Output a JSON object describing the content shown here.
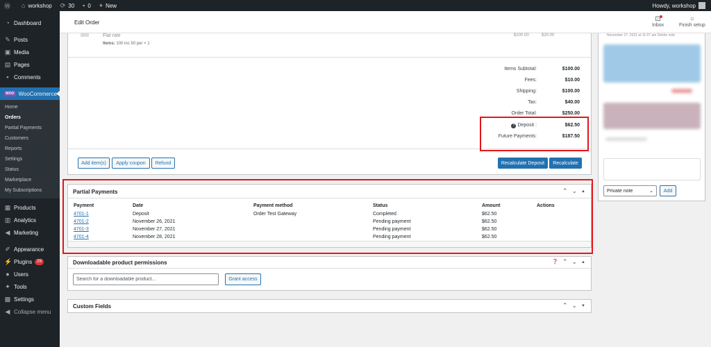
{
  "adminbar": {
    "site_name": "workshop",
    "updates_count": "30",
    "comments_count": "0",
    "new_label": "New",
    "howdy": "Howdy, workshop"
  },
  "sidebar": {
    "top_items": [
      {
        "label": "Dashboard",
        "icon": "dashboard-icon"
      },
      {
        "label": "Posts",
        "icon": "pin-icon"
      },
      {
        "label": "Media",
        "icon": "media-icon"
      },
      {
        "label": "Pages",
        "icon": "pages-icon"
      },
      {
        "label": "Comments",
        "icon": "comment-icon"
      }
    ],
    "woocommerce": {
      "label": "WooCommerce",
      "badge": "WOO"
    },
    "woo_submenu": [
      "Home",
      "Orders",
      "Partial Payments",
      "Customers",
      "Reports",
      "Settings",
      "Status",
      "Marketplace",
      "My Subscriptions"
    ],
    "active_submenu": "Orders",
    "bottom_items": [
      {
        "label": "Products"
      },
      {
        "label": "Analytics"
      },
      {
        "label": "Marketing"
      },
      {
        "label": "Appearance"
      },
      {
        "label": "Plugins",
        "badge": "29"
      },
      {
        "label": "Users"
      },
      {
        "label": "Tools"
      },
      {
        "label": "Settings"
      },
      {
        "label": "Collapse menu"
      }
    ]
  },
  "header": {
    "title": "Edit Order",
    "inbox_label": "Inbox",
    "finish_setup_label": "Finish setup"
  },
  "items": {
    "faded_shipping": "Flat rate",
    "faded_cost_1": "$100.00",
    "faded_cost_2": "$20.00",
    "meta_label": "Items:",
    "meta_value": "100 inc 50 per × 1"
  },
  "totals": {
    "subtotal_label": "Items Subtotal:",
    "subtotal_value": "$100.00",
    "fees_label": "Fees:",
    "fees_value": "$10.00",
    "shipping_label": "Shipping:",
    "shipping_value": "$100.00",
    "tax_label": "Tax:",
    "tax_value": "$40.00",
    "order_total_label": "Order Total:",
    "order_total_value": "$250.00",
    "deposit_label": "Deposit :",
    "deposit_value": "$62.50",
    "future_label": "Future Payments:",
    "future_value": "$187.50"
  },
  "actions": {
    "add_items": "Add item(s)",
    "apply_coupon": "Apply coupon",
    "refund": "Refund",
    "recalc_deposit": "Recalculate Deposit",
    "recalculate": "Recalculate"
  },
  "partial_payments": {
    "title": "Partial Payments",
    "columns": [
      "Payment",
      "Date",
      "Payment method",
      "Status",
      "Amount",
      "Actions"
    ],
    "rows": [
      {
        "payment": "4701-1",
        "date": "Deposit",
        "method": "Order Test Gateway",
        "status": "Completed",
        "amount": "$62.50"
      },
      {
        "payment": "4701-2",
        "date": "November 26, 2021",
        "method": "",
        "status": "Pending payment",
        "amount": "$62.50"
      },
      {
        "payment": "4701-3",
        "date": "November 27, 2021",
        "method": "",
        "status": "Pending payment",
        "amount": "$62.50"
      },
      {
        "payment": "4701-4",
        "date": "November 28, 2021",
        "method": "",
        "status": "Pending payment",
        "amount": "$62.50"
      }
    ]
  },
  "downloads": {
    "title": "Downloadable product permissions",
    "search_placeholder": "Search for a downloadable product...",
    "grant_label": "Grant access"
  },
  "custom_fields": {
    "title": "Custom Fields"
  },
  "notes": {
    "faded_text": "November 27, 2021 at 11:07 am Delete note",
    "note_type": "Private note",
    "add_label": "Add"
  },
  "colors": {
    "admin_dark": "#1d2327",
    "wp_blue": "#2271b1",
    "highlight_red": "#e5141a",
    "woo_purple": "#7f54b3"
  }
}
